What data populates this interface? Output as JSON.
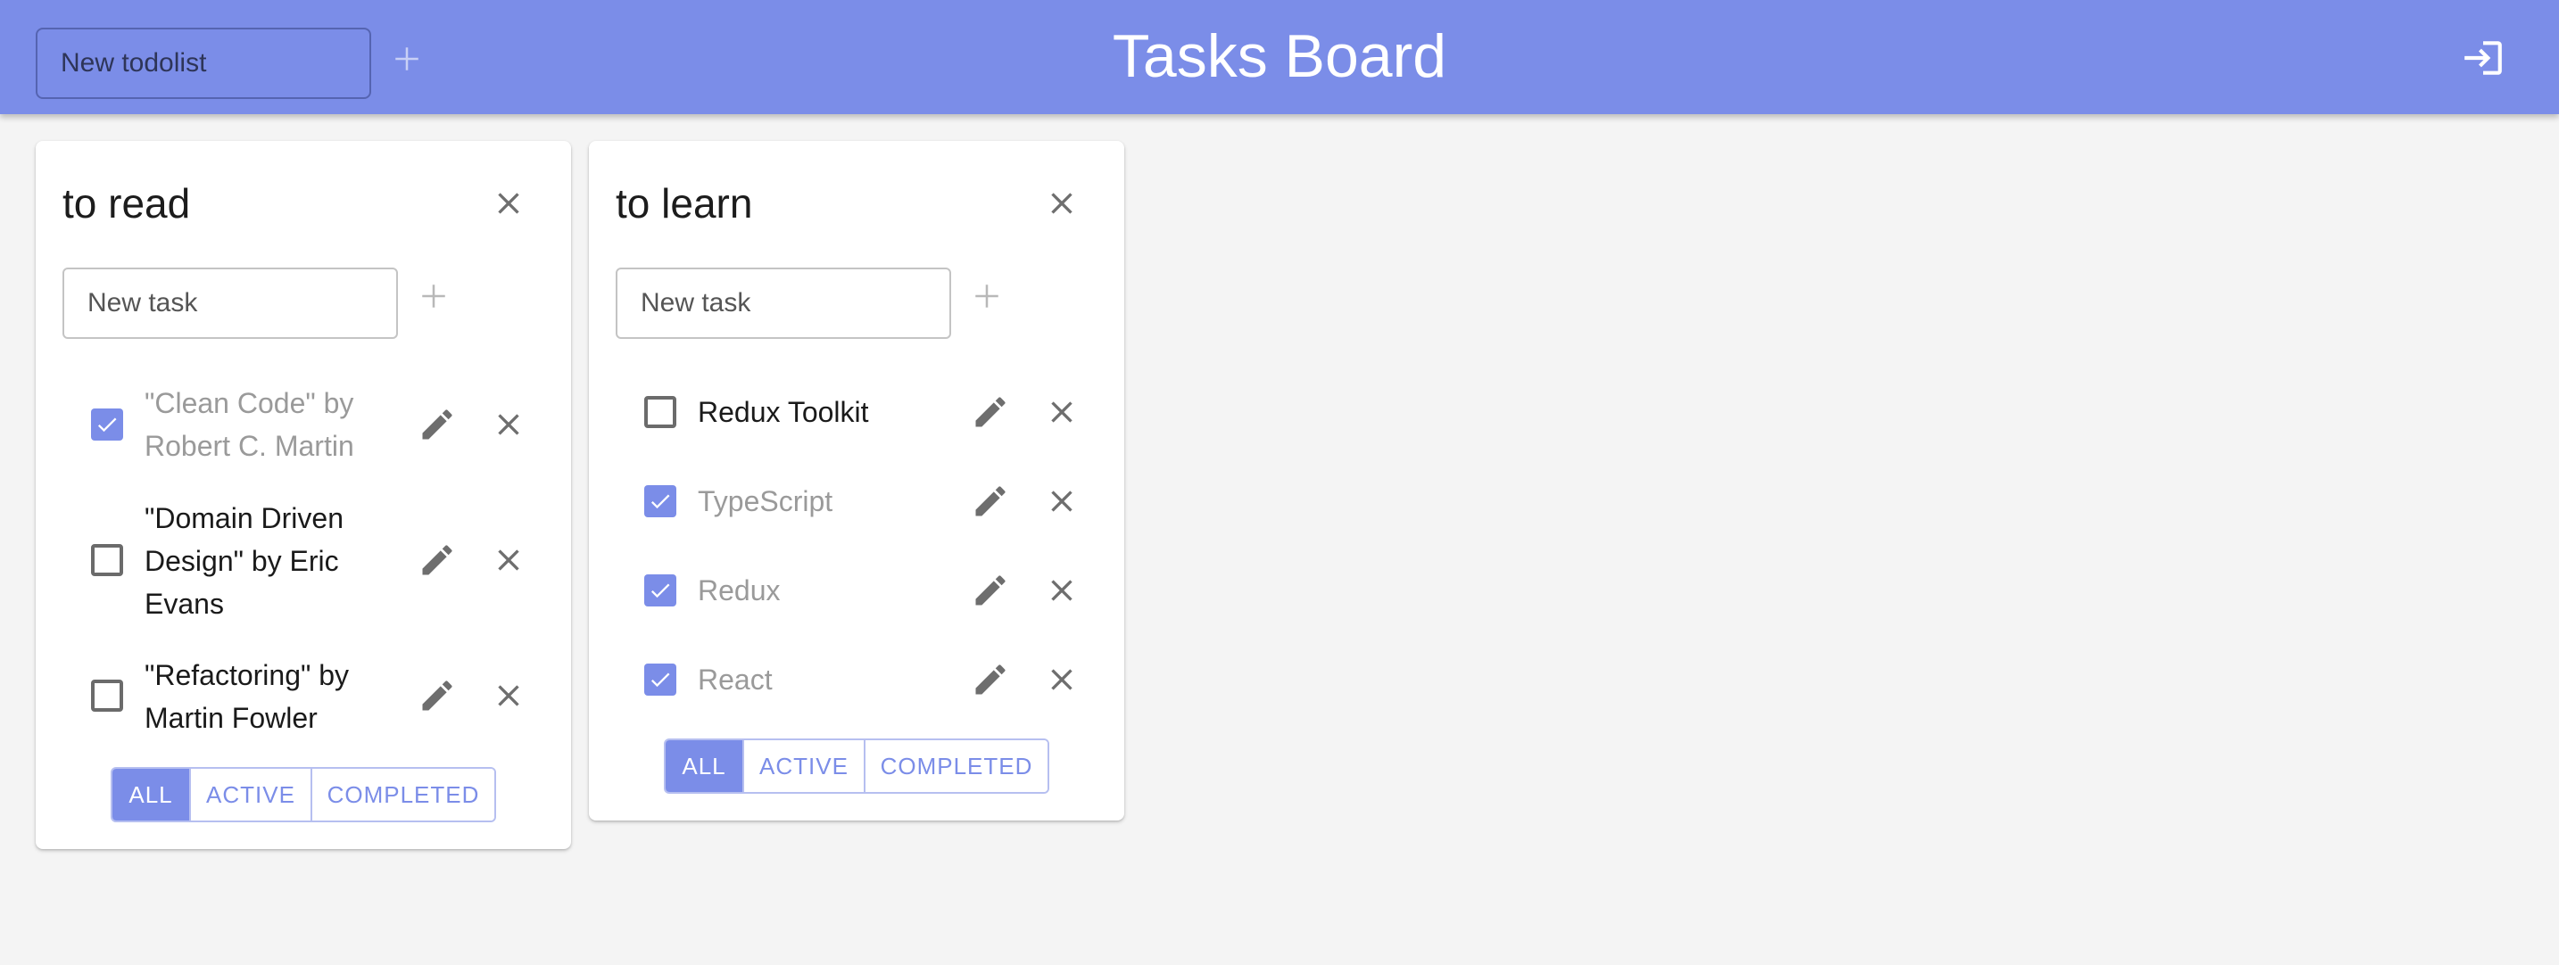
{
  "colors": {
    "primary": "#7b8de8",
    "background": "#f4f4f4"
  },
  "appbar": {
    "title": "Tasks Board",
    "new_todolist_placeholder": "New todolist",
    "add_icon": "plus-icon",
    "login_icon": "login-icon"
  },
  "todolists": [
    {
      "title": "to read",
      "new_task_placeholder": "New task",
      "tasks": [
        {
          "line1": "\"Clean Code\" by",
          "line2": "Robert C. Martin",
          "line3": "",
          "done": true
        },
        {
          "line1": "\"Domain Driven",
          "line2": "Design\" by Eric",
          "line3": "Evans",
          "done": false
        },
        {
          "line1": "\"Refactoring\" by",
          "line2": "Martin Fowler",
          "line3": "",
          "done": false
        }
      ],
      "filters": [
        "ALL",
        "ACTIVE",
        "COMPLETED"
      ],
      "active_filter": "ALL"
    },
    {
      "title": "to learn",
      "new_task_placeholder": "New task",
      "tasks": [
        {
          "line1": "Redux Toolkit",
          "done": false
        },
        {
          "line1": "TypeScript",
          "done": true
        },
        {
          "line1": "Redux",
          "done": true
        },
        {
          "line1": "React",
          "done": true
        }
      ],
      "filters": [
        "ALL",
        "ACTIVE",
        "COMPLETED"
      ],
      "active_filter": "ALL"
    }
  ]
}
